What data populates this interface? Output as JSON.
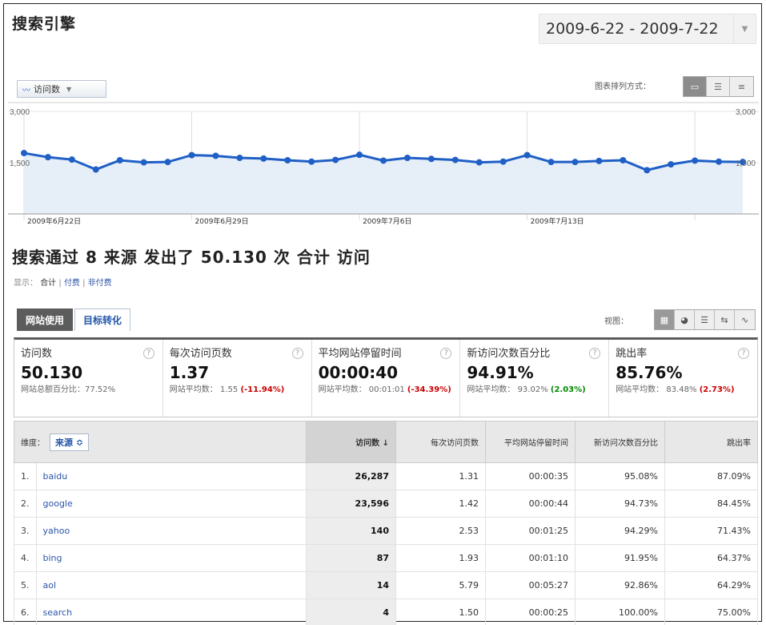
{
  "title": "搜索引擎",
  "date_range": "2009-6-22 - 2009-7-22",
  "metric_selector": "访问数",
  "view_label": "图表排列方式：",
  "chart_data": {
    "type": "area",
    "y_ticks": [
      "3,000",
      "1,500"
    ],
    "ylim": [
      0,
      3000
    ],
    "x_labels": [
      "2009年6月22日",
      "2009年6月29日",
      "2009年7月6日",
      "2009年7月13日"
    ],
    "values": [
      1780,
      1660,
      1590,
      1300,
      1570,
      1510,
      1520,
      1720,
      1700,
      1640,
      1620,
      1570,
      1530,
      1580,
      1730,
      1560,
      1640,
      1610,
      1580,
      1510,
      1530,
      1720,
      1520,
      1520,
      1550,
      1570,
      1280,
      1450,
      1560,
      1530,
      1520
    ]
  },
  "summary": "搜索通过 8 来源 发出了 50.130 次 合计 访问",
  "show": {
    "label": "显示：",
    "all": "合计",
    "sep1": "|",
    "paid": "付费",
    "sep2": "|",
    "nonpaid": "非付费"
  },
  "tabs": [
    "网站使用",
    "目标转化"
  ],
  "display_label": "视图：",
  "scorecards": [
    {
      "label": "访问数",
      "value": "50.130",
      "sub": "网站总额百分比：77.52%",
      "change": ""
    },
    {
      "label": "每次访问页数",
      "value": "1.37",
      "sub": "网站平均数： 1.55",
      "change": "(-11.94%)"
    },
    {
      "label": "平均网站停留时间",
      "value": "00:00:40",
      "sub": "网站平均数： 00:01:01",
      "change": "(-34.39%)"
    },
    {
      "label": "新访问次数百分比",
      "value": "94.91%",
      "sub": "网站平均数： 93.02%",
      "change": "(2.03%)"
    },
    {
      "label": "跳出率",
      "value": "85.76%",
      "sub": "网站平均数： 83.48%",
      "change": "(2.73%)"
    }
  ],
  "table": {
    "dimension_label": "维度：",
    "dimension_value": "来源",
    "headers": [
      "访问数 ↓",
      "每次访问页数",
      "平均网站停留时间",
      "新访问次数百分比",
      "跳出率"
    ],
    "rows": [
      {
        "n": "1.",
        "source": "baidu",
        "visits": "26,287",
        "ppv": "1.31",
        "time": "00:00:35",
        "newpct": "95.08%",
        "bounce": "87.09%"
      },
      {
        "n": "2.",
        "source": "google",
        "visits": "23,596",
        "ppv": "1.42",
        "time": "00:00:44",
        "newpct": "94.73%",
        "bounce": "84.45%"
      },
      {
        "n": "3.",
        "source": "yahoo",
        "visits": "140",
        "ppv": "2.53",
        "time": "00:01:25",
        "newpct": "94.29%",
        "bounce": "71.43%"
      },
      {
        "n": "4.",
        "source": "bing",
        "visits": "87",
        "ppv": "1.93",
        "time": "00:01:10",
        "newpct": "91.95%",
        "bounce": "64.37%"
      },
      {
        "n": "5.",
        "source": "aol",
        "visits": "14",
        "ppv": "5.79",
        "time": "00:05:27",
        "newpct": "92.86%",
        "bounce": "64.29%"
      },
      {
        "n": "6.",
        "source": "search",
        "visits": "4",
        "ppv": "1.50",
        "time": "00:00:25",
        "newpct": "100.00%",
        "bounce": "75.00%"
      }
    ]
  },
  "colors": {
    "line": "#1f5fc6",
    "fill": "#e6eef8",
    "neg": "#cc0000",
    "pos": "#008800"
  }
}
